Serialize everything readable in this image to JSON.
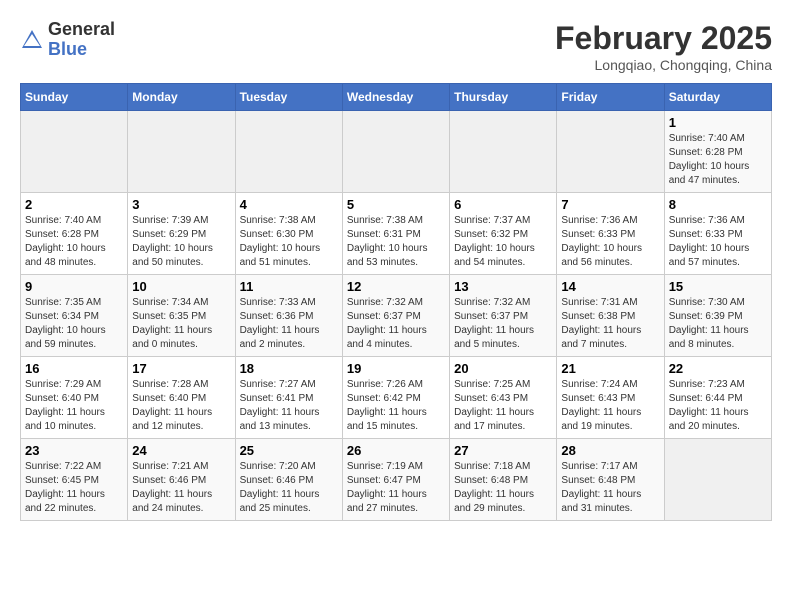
{
  "header": {
    "logo_general": "General",
    "logo_blue": "Blue",
    "month_title": "February 2025",
    "location": "Longqiao, Chongqing, China"
  },
  "weekdays": [
    "Sunday",
    "Monday",
    "Tuesday",
    "Wednesday",
    "Thursday",
    "Friday",
    "Saturday"
  ],
  "weeks": [
    [
      {
        "day": "",
        "info": ""
      },
      {
        "day": "",
        "info": ""
      },
      {
        "day": "",
        "info": ""
      },
      {
        "day": "",
        "info": ""
      },
      {
        "day": "",
        "info": ""
      },
      {
        "day": "",
        "info": ""
      },
      {
        "day": "1",
        "info": "Sunrise: 7:40 AM\nSunset: 6:28 PM\nDaylight: 10 hours\nand 47 minutes."
      }
    ],
    [
      {
        "day": "2",
        "info": "Sunrise: 7:40 AM\nSunset: 6:28 PM\nDaylight: 10 hours\nand 48 minutes."
      },
      {
        "day": "3",
        "info": "Sunrise: 7:39 AM\nSunset: 6:29 PM\nDaylight: 10 hours\nand 50 minutes."
      },
      {
        "day": "4",
        "info": "Sunrise: 7:38 AM\nSunset: 6:30 PM\nDaylight: 10 hours\nand 51 minutes."
      },
      {
        "day": "5",
        "info": "Sunrise: 7:38 AM\nSunset: 6:31 PM\nDaylight: 10 hours\nand 53 minutes."
      },
      {
        "day": "6",
        "info": "Sunrise: 7:37 AM\nSunset: 6:32 PM\nDaylight: 10 hours\nand 54 minutes."
      },
      {
        "day": "7",
        "info": "Sunrise: 7:36 AM\nSunset: 6:33 PM\nDaylight: 10 hours\nand 56 minutes."
      },
      {
        "day": "8",
        "info": "Sunrise: 7:36 AM\nSunset: 6:33 PM\nDaylight: 10 hours\nand 57 minutes."
      }
    ],
    [
      {
        "day": "9",
        "info": "Sunrise: 7:35 AM\nSunset: 6:34 PM\nDaylight: 10 hours\nand 59 minutes."
      },
      {
        "day": "10",
        "info": "Sunrise: 7:34 AM\nSunset: 6:35 PM\nDaylight: 11 hours\nand 0 minutes."
      },
      {
        "day": "11",
        "info": "Sunrise: 7:33 AM\nSunset: 6:36 PM\nDaylight: 11 hours\nand 2 minutes."
      },
      {
        "day": "12",
        "info": "Sunrise: 7:32 AM\nSunset: 6:37 PM\nDaylight: 11 hours\nand 4 minutes."
      },
      {
        "day": "13",
        "info": "Sunrise: 7:32 AM\nSunset: 6:37 PM\nDaylight: 11 hours\nand 5 minutes."
      },
      {
        "day": "14",
        "info": "Sunrise: 7:31 AM\nSunset: 6:38 PM\nDaylight: 11 hours\nand 7 minutes."
      },
      {
        "day": "15",
        "info": "Sunrise: 7:30 AM\nSunset: 6:39 PM\nDaylight: 11 hours\nand 8 minutes."
      }
    ],
    [
      {
        "day": "16",
        "info": "Sunrise: 7:29 AM\nSunset: 6:40 PM\nDaylight: 11 hours\nand 10 minutes."
      },
      {
        "day": "17",
        "info": "Sunrise: 7:28 AM\nSunset: 6:40 PM\nDaylight: 11 hours\nand 12 minutes."
      },
      {
        "day": "18",
        "info": "Sunrise: 7:27 AM\nSunset: 6:41 PM\nDaylight: 11 hours\nand 13 minutes."
      },
      {
        "day": "19",
        "info": "Sunrise: 7:26 AM\nSunset: 6:42 PM\nDaylight: 11 hours\nand 15 minutes."
      },
      {
        "day": "20",
        "info": "Sunrise: 7:25 AM\nSunset: 6:43 PM\nDaylight: 11 hours\nand 17 minutes."
      },
      {
        "day": "21",
        "info": "Sunrise: 7:24 AM\nSunset: 6:43 PM\nDaylight: 11 hours\nand 19 minutes."
      },
      {
        "day": "22",
        "info": "Sunrise: 7:23 AM\nSunset: 6:44 PM\nDaylight: 11 hours\nand 20 minutes."
      }
    ],
    [
      {
        "day": "23",
        "info": "Sunrise: 7:22 AM\nSunset: 6:45 PM\nDaylight: 11 hours\nand 22 minutes."
      },
      {
        "day": "24",
        "info": "Sunrise: 7:21 AM\nSunset: 6:46 PM\nDaylight: 11 hours\nand 24 minutes."
      },
      {
        "day": "25",
        "info": "Sunrise: 7:20 AM\nSunset: 6:46 PM\nDaylight: 11 hours\nand 25 minutes."
      },
      {
        "day": "26",
        "info": "Sunrise: 7:19 AM\nSunset: 6:47 PM\nDaylight: 11 hours\nand 27 minutes."
      },
      {
        "day": "27",
        "info": "Sunrise: 7:18 AM\nSunset: 6:48 PM\nDaylight: 11 hours\nand 29 minutes."
      },
      {
        "day": "28",
        "info": "Sunrise: 7:17 AM\nSunset: 6:48 PM\nDaylight: 11 hours\nand 31 minutes."
      },
      {
        "day": "",
        "info": ""
      }
    ]
  ]
}
